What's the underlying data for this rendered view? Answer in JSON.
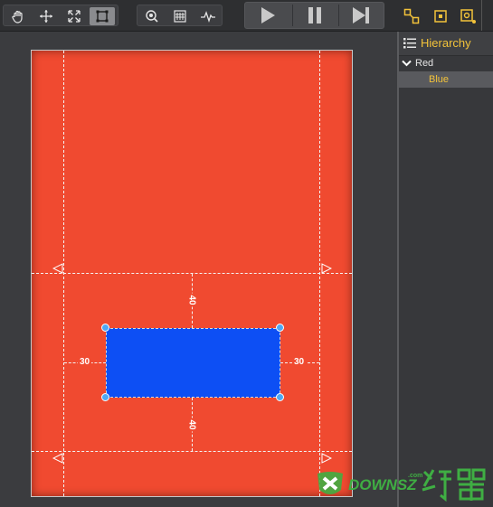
{
  "toolbar": {
    "tools": [
      {
        "name": "hand-tool",
        "icon": "hand-icon"
      },
      {
        "name": "move-tool",
        "icon": "move-arrows-icon"
      },
      {
        "name": "scale-tool",
        "icon": "scale-arrows-icon"
      },
      {
        "name": "rect-tool",
        "icon": "rect-transform-icon",
        "active": true
      }
    ],
    "view_tools": [
      "zoom-icon",
      "stats-icon",
      "profiler-icon"
    ],
    "playback": [
      "play-icon",
      "pause-icon",
      "step-icon"
    ],
    "gizmos": [
      "anchor-gizmo-icon",
      "rect-gizmo-icon",
      "pivot-gizmo-icon"
    ]
  },
  "scene": {
    "canvas_color": "#f04a30",
    "blue_node_color": "#0d4ff4",
    "margins": {
      "top": "40",
      "bottom": "40",
      "left": "30",
      "right": "30"
    }
  },
  "hierarchy": {
    "title": "Hierarchy",
    "items": [
      {
        "label": "Red",
        "expanded": true,
        "selected": false
      },
      {
        "label": "Blue",
        "selected": true
      }
    ]
  },
  "watermark": {
    "brand": "DOWNSZ",
    "domain": ".com"
  },
  "colors": {
    "accent_yellow": "#f3c33a",
    "handle_blue": "#4ea8f5"
  }
}
